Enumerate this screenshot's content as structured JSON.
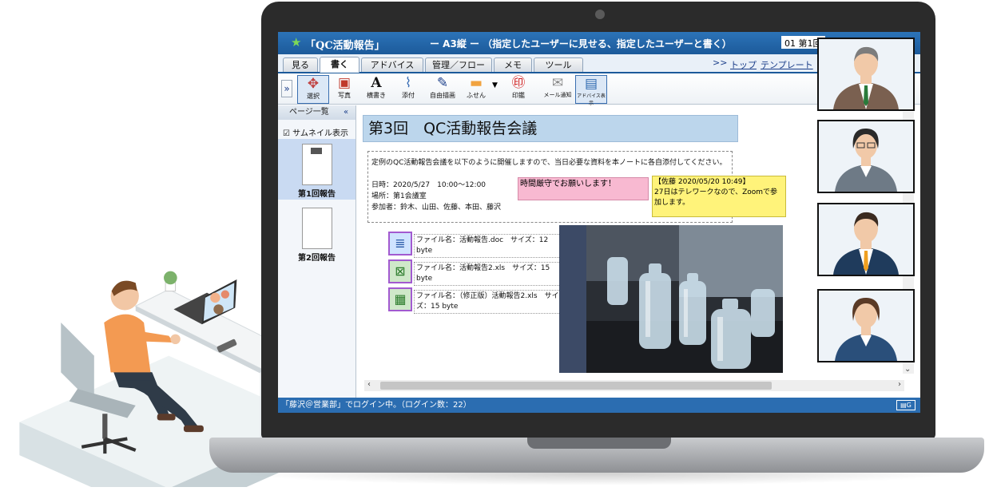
{
  "app": {
    "title": "「QC活動報告」",
    "subtitle": "ー A3縦 ー （指定したユーザーに見せる、指定したユーザーと書く）",
    "page_indicator": "01 第1回"
  },
  "tabs": [
    {
      "label": "見る",
      "active": false
    },
    {
      "label": "書く",
      "active": true
    },
    {
      "label": "アドバイス",
      "active": false
    },
    {
      "label": "管理／フロー",
      "active": false
    },
    {
      "label": "メモ",
      "active": false
    },
    {
      "label": "ツール",
      "active": false
    }
  ],
  "nav_links": {
    "arrow": ">>",
    "top": "トップ",
    "template": "テンプレート"
  },
  "toolbar": {
    "expand": "»",
    "items": [
      {
        "label": "選択",
        "icon": "cursor-icon",
        "selected": true
      },
      {
        "label": "写真",
        "icon": "photo-icon"
      },
      {
        "label": "横書き",
        "icon": "text-icon"
      },
      {
        "label": "添付",
        "icon": "paperclip-icon"
      },
      {
        "label": "自由描画",
        "icon": "draw-icon"
      },
      {
        "label": "ふせん",
        "icon": "sticky-note-icon"
      },
      {
        "label": "印鑑",
        "icon": "stamp-icon"
      },
      {
        "label": "メール通知",
        "icon": "mail-icon"
      },
      {
        "label": "アドバイス表示",
        "icon": "advice-icon"
      }
    ]
  },
  "sidebar": {
    "header": "ページ一覧",
    "collapse": "«",
    "thumbnail_toggle": "サムネイル表示",
    "pages": [
      {
        "label": "第1回報告",
        "selected": true
      },
      {
        "label": "第2回報告",
        "selected": false
      }
    ]
  },
  "page": {
    "title": "第3回　QC活動報告会議",
    "intro": "定例のQC活動報告会議を以下のように開催しますので、当日必要な資料を本ノートに各自添付してください。",
    "datetime": "日時：2020/5/27　10:00～12:00",
    "place": "場所：第1会議室",
    "attendees": "参加者：鈴木、山田、佐藤、本田、藤沢",
    "pink_note": "時間厳守でお願いします！",
    "yellow_note_header": "【佐藤 2020/05/20 10:49】",
    "yellow_note_body": "27日はテレワークなので、Zoomで参加します。",
    "files": [
      "ファイル名：活動報告.doc　サイズ：12 byte",
      "ファイル名：活動報告2.xls　サイズ：15 byte",
      "ファイル名：（修正版）活動報告2.xls　サイズ：15 byte"
    ]
  },
  "status": {
    "text": "「藤沢＠営業部」でログイン中。（ログイン数：22）"
  },
  "colors": {
    "titlebar": "#1c5a9a",
    "page_title_bg": "#bcd6ec",
    "pink_note": "#f8b9d1",
    "yellow_note": "#fff37a"
  }
}
